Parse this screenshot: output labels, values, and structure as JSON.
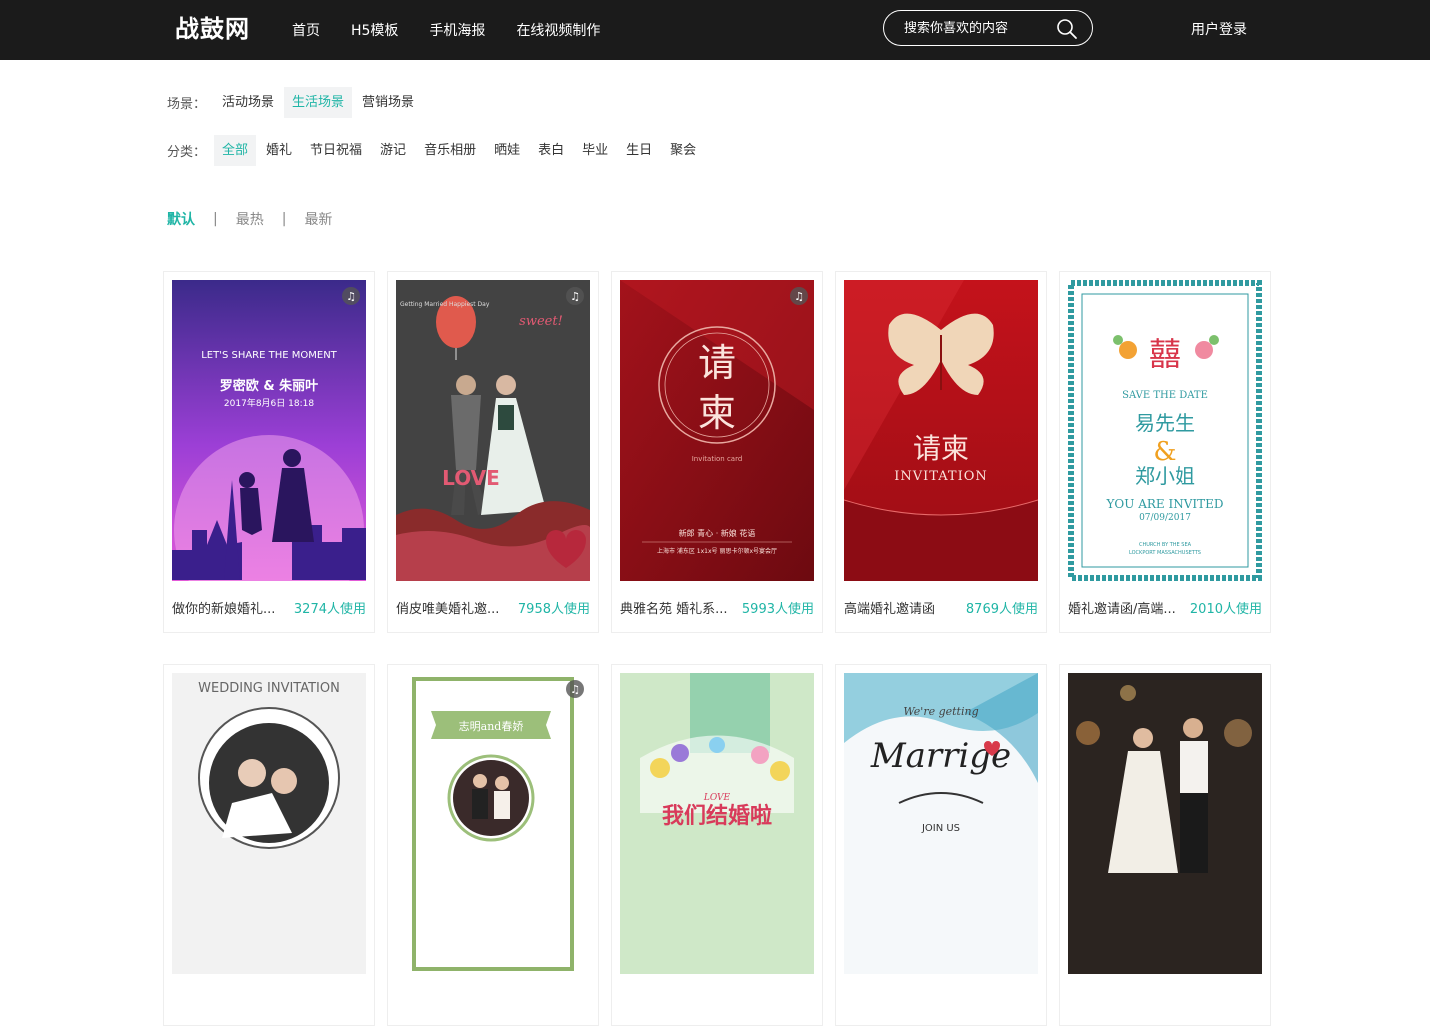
{
  "logo": "战鼓网",
  "nav": [
    "首页",
    "H5模板",
    "手机海报",
    "在线视频制作"
  ],
  "search": {
    "placeholder": "搜索你喜欢的内容"
  },
  "login": "用户登录",
  "filters": {
    "scene_label": "场景：",
    "scenes": [
      "活动场景",
      "生活场景",
      "营销场景"
    ],
    "scene_active": "生活场景",
    "category_label": "分类：",
    "categories": [
      "全部",
      "婚礼",
      "节日祝福",
      "游记",
      "音乐相册",
      "晒娃",
      "表白",
      "毕业",
      "生日",
      "聚会"
    ],
    "category_active": "全部"
  },
  "sort": {
    "items": [
      "默认",
      "最热",
      "最新"
    ],
    "active": "默认",
    "separator": "|"
  },
  "templates": [
    {
      "title": "做你的新娘婚礼...",
      "usage": "3274人使用",
      "music": true,
      "img_text": [
        "LET'S SHARE THE MOMENT",
        "罗密欧 & 朱丽叶",
        "2017年8月6日 18:18"
      ]
    },
    {
      "title": "俏皮唯美婚礼邀...",
      "usage": "7958人使用",
      "music": true,
      "img_text": [
        "sweet!",
        "LOVE",
        "Getting Married Happiest Day"
      ]
    },
    {
      "title": "典雅名苑 婚礼系...",
      "usage": "5993人使用",
      "music": true,
      "img_text": [
        "请",
        "柬",
        "Invitation card",
        "新郎 青心 · 新娘 花语",
        "上海市 浦东区 1x1x号 丽思卡尔顿x号宴会厅"
      ]
    },
    {
      "title": "高端婚礼邀请函",
      "usage": "8769人使用",
      "music": false,
      "img_text": [
        "请柬",
        "INVITATION"
      ]
    },
    {
      "title": "婚礼邀请函/高端...",
      "usage": "2010人使用",
      "music": false,
      "img_text": [
        "囍",
        "SAVE THE DATE",
        "易先生",
        "&",
        "郑小姐",
        "YOU ARE INVITED",
        "07/09/2017",
        "CHURCH BY THE SEA",
        "LOCKPORT MASSACHUSETTS"
      ]
    },
    {
      "title": "",
      "usage": "",
      "music": false,
      "img_text": [
        "WEDDING INVITATION"
      ]
    },
    {
      "title": "",
      "usage": "",
      "music": true,
      "img_text": [
        "志明and春娇"
      ]
    },
    {
      "title": "",
      "usage": "",
      "music": false,
      "img_text": [
        "LOVE",
        "我们结婚啦"
      ]
    },
    {
      "title": "",
      "usage": "",
      "music": false,
      "img_text": [
        "We're getting",
        "Marrige",
        "JOIN US"
      ]
    },
    {
      "title": "",
      "usage": "",
      "music": false,
      "img_text": []
    }
  ],
  "colors": {
    "accent": "#20b5a6",
    "topbar": "#1b1b1b"
  }
}
